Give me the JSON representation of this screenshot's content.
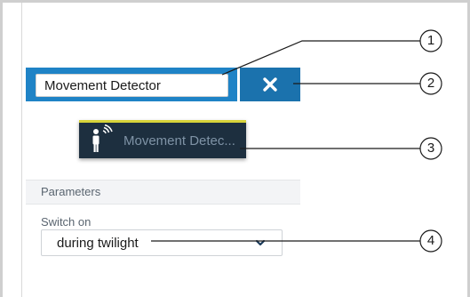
{
  "panel": {
    "name_value": "Movement Detector",
    "close_icon": "close-icon",
    "accent": "#1f83c6"
  },
  "tile": {
    "label": "Movement Detec...",
    "icon": "motion-sensor-icon",
    "accent": "#d7d33a"
  },
  "parameters": {
    "header": "Parameters",
    "switch_on_label": "Switch on",
    "switch_on_value": "during twilight",
    "dropdown_icon": "chevron-down-icon"
  },
  "callouts": [
    "1",
    "2",
    "3",
    "4"
  ]
}
